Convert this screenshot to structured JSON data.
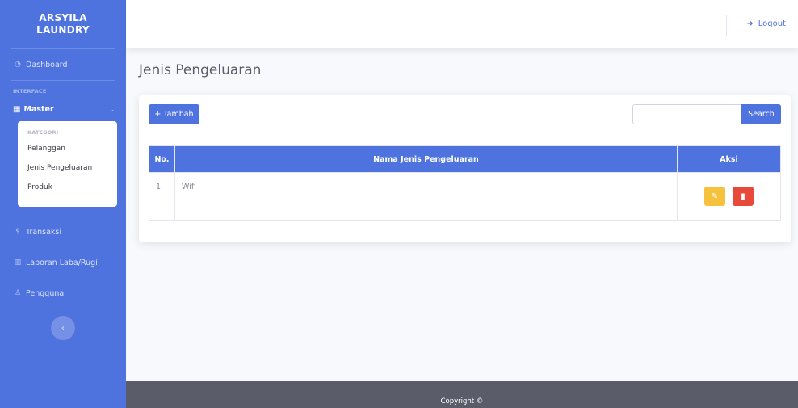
{
  "brand": {
    "line1": "ARSYILA",
    "line2": "LAUNDRY"
  },
  "sidebar": {
    "dashboard": {
      "label": "Dashboard",
      "icon": "tachometer-icon"
    },
    "heading_interface": "INTERFACE",
    "master": {
      "label": "Master",
      "icon": "table-icon"
    },
    "collapse": {
      "heading": "KATEGORI",
      "items": [
        "Pelanggan",
        "Jenis Pengeluaran",
        "Produk"
      ]
    },
    "transaksi": {
      "label": "Transaksi",
      "icon": "dollar-icon"
    },
    "laporan": {
      "label": "Laporan Laba/Rugi",
      "icon": "chart-icon"
    },
    "pengguna": {
      "label": "Pengguna",
      "icon": "user-icon"
    }
  },
  "topbar": {
    "logout_label": "Logout"
  },
  "page": {
    "title": "Jenis Pengeluaran"
  },
  "toolbar": {
    "add_label": "+ Tambah",
    "search_label": "Search",
    "search_value": ""
  },
  "table": {
    "headers": {
      "no": "No.",
      "name": "Nama Jenis Pengeluaran",
      "aksi": "Aksi"
    },
    "rows": [
      {
        "no": "1",
        "name": "Wifi"
      }
    ]
  },
  "footer": {
    "text": "Copyright ©"
  },
  "colors": {
    "primary": "#4e73df",
    "warning": "#f6c23e",
    "danger": "#e74a3b",
    "footer": "#5a5c69"
  }
}
